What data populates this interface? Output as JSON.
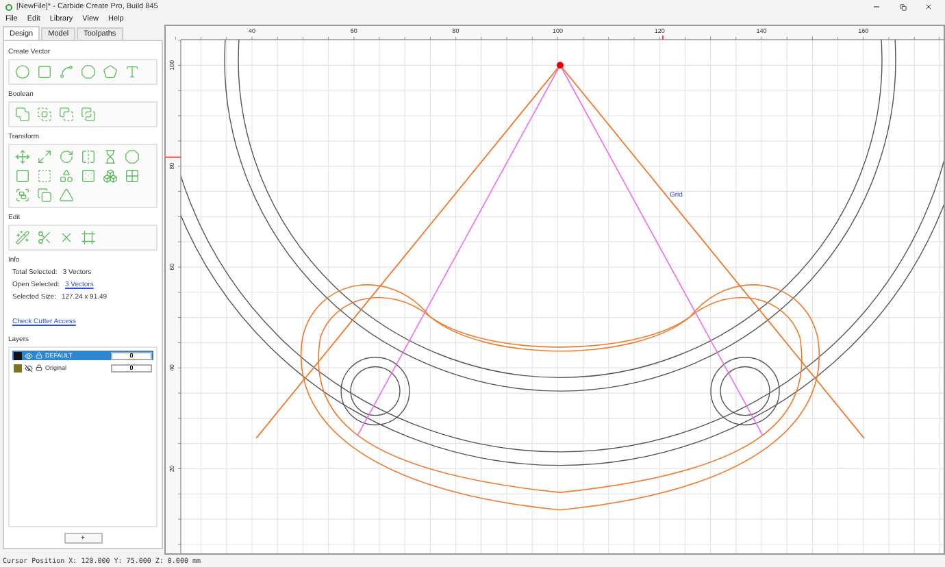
{
  "window": {
    "title": "[NewFile]* - Carbide Create Pro, Build 845"
  },
  "menu": [
    "File",
    "Edit",
    "Library",
    "View",
    "Help"
  ],
  "tabs": [
    {
      "label": "Design",
      "selected": true
    },
    {
      "label": "Model",
      "selected": false
    },
    {
      "label": "Toolpaths",
      "selected": false
    }
  ],
  "sections": [
    {
      "kind": "create",
      "title": "Create Vector"
    },
    {
      "kind": "boolean",
      "title": "Boolean"
    },
    {
      "kind": "transform",
      "title": "Transform"
    },
    {
      "kind": "edit",
      "title": "Edit"
    }
  ],
  "info": {
    "title": "Info",
    "rows": [
      {
        "label": "Total Selected:",
        "value": "3 Vectors",
        "link": false
      },
      {
        "label": "Open Selected:",
        "value": "3 Vectors",
        "link": true
      },
      {
        "label": "Selected Size:",
        "value": "127.24 x 91.49",
        "link": false
      }
    ],
    "link": "Check Cutter Access"
  },
  "layers": {
    "title": "Layers",
    "items": [
      {
        "name": "DEFAULT",
        "color": "#111111",
        "selected": true,
        "visible": true,
        "count": "0"
      },
      {
        "name": "Original",
        "color": "#7a7420",
        "selected": false,
        "visible": false,
        "count": "0"
      }
    ],
    "add_button": "+"
  },
  "canvas": {
    "x_ruler": [
      "40",
      "60",
      "80",
      "100",
      "120",
      "140",
      "160"
    ],
    "y_ruler": [
      "100",
      "80",
      "60",
      "40",
      "20"
    ],
    "grid_label": "Grid"
  },
  "status_bar": "Cursor Position X: 120.000 Y: 75.000 Z: 0.000 mm"
}
